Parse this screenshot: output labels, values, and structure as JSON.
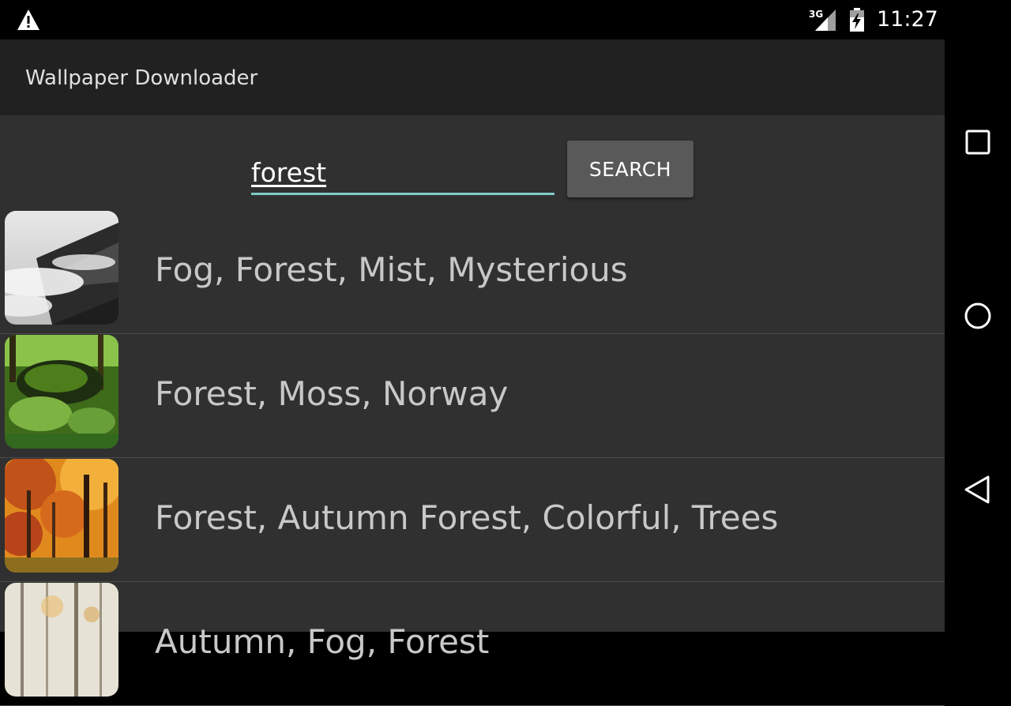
{
  "status_bar": {
    "time": "11:27",
    "network": "3G",
    "icons": [
      "warning-icon",
      "signal-icon",
      "battery-charging-icon"
    ]
  },
  "app_bar": {
    "title": "Wallpaper Downloader"
  },
  "search": {
    "value": "forest",
    "button_label": "SEARCH",
    "accent_color": "#80cbc4"
  },
  "results": [
    {
      "title": "Fog, Forest, Mist, Mysterious",
      "thumbnail": "foggy-forest-thumbnail"
    },
    {
      "title": "Forest, Moss, Norway",
      "thumbnail": "mossy-forest-thumbnail"
    },
    {
      "title": "Forest, Autumn Forest, Colorful, Trees",
      "thumbnail": "autumn-forest-thumbnail"
    },
    {
      "title": "Autumn, Fog, Forest",
      "thumbnail": "misty-autumn-forest-thumbnail"
    }
  ],
  "nav": {
    "icons": [
      "recents-icon",
      "home-icon",
      "back-icon"
    ]
  }
}
